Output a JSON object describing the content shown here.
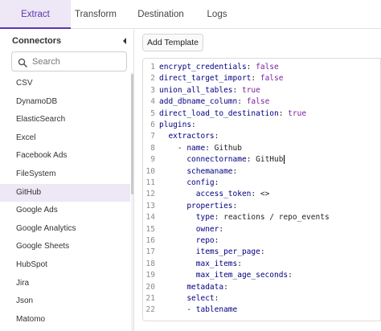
{
  "tabs": [
    {
      "label": "Extract"
    },
    {
      "label": "Transform"
    },
    {
      "label": "Destination"
    },
    {
      "label": "Logs"
    }
  ],
  "sidebar": {
    "title": "Connectors",
    "search_placeholder": "Search",
    "items": [
      {
        "label": "CSV"
      },
      {
        "label": "DynamoDB"
      },
      {
        "label": "ElasticSearch"
      },
      {
        "label": "Excel"
      },
      {
        "label": "Facebook Ads"
      },
      {
        "label": "FileSystem"
      },
      {
        "label": "GitHub"
      },
      {
        "label": "Google Ads"
      },
      {
        "label": "Google Analytics"
      },
      {
        "label": "Google Sheets"
      },
      {
        "label": "HubSpot"
      },
      {
        "label": "Jira"
      },
      {
        "label": "Json"
      },
      {
        "label": "Matomo"
      }
    ],
    "selected": "GitHub"
  },
  "main": {
    "add_template_label": "Add Template"
  },
  "editor": {
    "lines": [
      {
        "n": "1",
        "indent": "",
        "key": "encrypt_credentials",
        "sep": ": ",
        "val": "false",
        "type": "bool"
      },
      {
        "n": "2",
        "indent": "",
        "key": "direct_target_import",
        "sep": ": ",
        "val": "false",
        "type": "bool"
      },
      {
        "n": "3",
        "indent": "",
        "key": "union_all_tables",
        "sep": ": ",
        "val": "true",
        "type": "bool"
      },
      {
        "n": "4",
        "indent": "",
        "key": "add_dbname_column",
        "sep": ": ",
        "val": "false",
        "type": "bool"
      },
      {
        "n": "5",
        "indent": "",
        "key": "direct_load_to_destination",
        "sep": ": ",
        "val": "true",
        "type": "bool"
      },
      {
        "n": "6",
        "indent": "",
        "key": "plugins",
        "sep": ":",
        "val": "",
        "type": "none"
      },
      {
        "n": "7",
        "indent": "  ",
        "key": "extractors",
        "sep": ":",
        "val": "",
        "type": "none"
      },
      {
        "n": "8",
        "indent": "    - ",
        "key": "name",
        "sep": ": ",
        "val": "Github",
        "type": "str"
      },
      {
        "n": "9",
        "indent": "      ",
        "key": "connectorname",
        "sep": ": ",
        "val": "GitHub",
        "type": "str"
      },
      {
        "n": "10",
        "indent": "      ",
        "key": "schemaname",
        "sep": ":",
        "val": "",
        "type": "none"
      },
      {
        "n": "11",
        "indent": "      ",
        "key": "config",
        "sep": ":",
        "val": "",
        "type": "none"
      },
      {
        "n": "12",
        "indent": "        ",
        "key": "access_token",
        "sep": ": ",
        "val": "<>",
        "type": "str"
      },
      {
        "n": "13",
        "indent": "      ",
        "key": "properties",
        "sep": ":",
        "val": "",
        "type": "none"
      },
      {
        "n": "14",
        "indent": "        ",
        "key": "type",
        "sep": ": ",
        "val": "reactions / repo_events",
        "type": "str"
      },
      {
        "n": "15",
        "indent": "        ",
        "key": "owner",
        "sep": ":",
        "val": "",
        "type": "none"
      },
      {
        "n": "16",
        "indent": "        ",
        "key": "repo",
        "sep": ":",
        "val": "",
        "type": "none"
      },
      {
        "n": "17",
        "indent": "        ",
        "key": "items_per_page",
        "sep": ":",
        "val": "",
        "type": "none"
      },
      {
        "n": "18",
        "indent": "        ",
        "key": "max_items",
        "sep": ":",
        "val": "",
        "type": "none"
      },
      {
        "n": "19",
        "indent": "        ",
        "key": "max_item_age_seconds",
        "sep": ":",
        "val": "",
        "type": "none"
      },
      {
        "n": "20",
        "indent": "      ",
        "key": "metadata",
        "sep": ":",
        "val": "",
        "type": "none"
      },
      {
        "n": "21",
        "indent": "      ",
        "key": "select",
        "sep": ":",
        "val": "",
        "type": "none"
      },
      {
        "n": "22",
        "indent": "      - ",
        "key": "tablename",
        "sep": "",
        "val": "",
        "type": "none"
      }
    ],
    "cursor_line": "9"
  },
  "colors": {
    "accent": "#5e35b1",
    "selected_bg": "#ede7f6",
    "key": "#000080",
    "bool": "#7a1fa2"
  }
}
